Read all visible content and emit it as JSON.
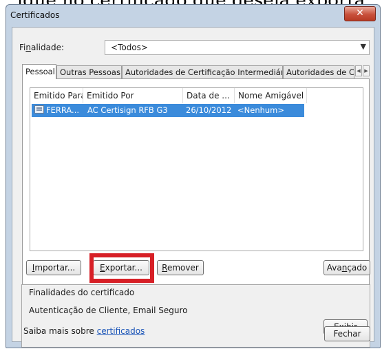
{
  "background_caption": "ique no certificado que deseja exporta",
  "window": {
    "title": "Certificados",
    "close_symbol": "✕"
  },
  "purpose": {
    "label_prefix": "Fi",
    "label_underlined": "n",
    "label_suffix": "alidade:",
    "selected": "<Todos>",
    "arrow": "▼"
  },
  "tabs": [
    {
      "label": "Pessoal"
    },
    {
      "label": "Outras Pessoas"
    },
    {
      "label": "Autoridades de Certificação Intermediárias"
    },
    {
      "label": "Autoridades de Ce"
    }
  ],
  "tab_scroll": {
    "left": "◀",
    "right": "▶"
  },
  "list": {
    "columns": [
      "Emitido Para",
      "Emitido Por",
      "Data de ...",
      "Nome Amigável"
    ],
    "rows": [
      {
        "issued_to": "FERRA...",
        "issued_by": "AC Certisign RFB G3",
        "date": "26/10/2012",
        "friendly_name": "<Nenhum>",
        "selected": true
      }
    ]
  },
  "buttons": {
    "import": {
      "underlined": "I",
      "rest": "mportar..."
    },
    "export": {
      "underlined": "E",
      "rest": "xportar..."
    },
    "remove": {
      "underlined": "R",
      "rest": "emover"
    },
    "advanced": {
      "prefix": "Ava",
      "underlined": "n",
      "rest": "çado"
    },
    "view": {
      "prefix": "E",
      "underlined": "x",
      "rest": "ibir"
    },
    "close": "Fechar"
  },
  "purposes_group": {
    "title": "Finalidades do certificado",
    "value": "Autenticação de Cliente, Email Seguro"
  },
  "footer": {
    "learn_more": "Saiba mais sobre ",
    "link": "certificados"
  },
  "colors": {
    "selection": "#3b8bdb",
    "highlight_box": "#d71f26",
    "link": "#1b55b8"
  }
}
